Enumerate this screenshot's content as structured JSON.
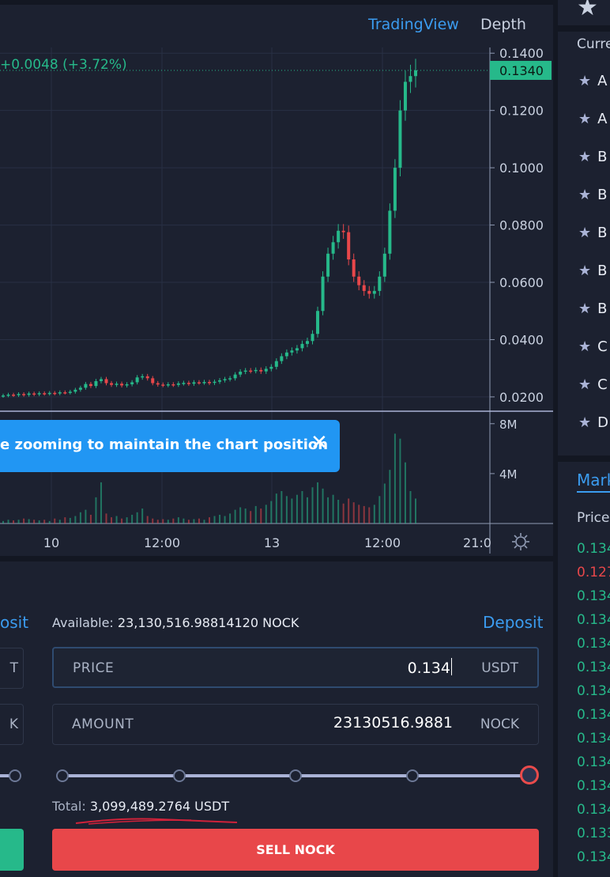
{
  "chart": {
    "tabs": {
      "tradingview": "TradingView",
      "depth": "Depth"
    },
    "change_text": "+0.0048 (+3.72%)",
    "current_price": "0.1340",
    "price_axis": [
      "0.1400",
      "0.1200",
      "0.1000",
      "0.0800",
      "0.0600",
      "0.0400",
      "0.0200"
    ],
    "volume_axis": [
      "8M",
      "4M"
    ],
    "time_axis": [
      "10",
      "12:00",
      "13",
      "12:00",
      "21:0"
    ],
    "notice_text": "e zooming to maintain the chart position",
    "colors": {
      "up": "#26b98a",
      "down": "#e8474a",
      "accent": "#3b9cf0"
    }
  },
  "order": {
    "left_deposit": "osit",
    "left_price_unit": "T",
    "left_amount_unit": "K",
    "available_label": "Available:",
    "available_value": "23,130,516.98814120 NOCK",
    "deposit_label": "Deposit",
    "price_label": "PRICE",
    "price_value": "0.134",
    "price_unit": "USDT",
    "amount_label": "AMOUNT",
    "amount_value": "23130516.9881",
    "amount_unit": "NOCK",
    "slider_percent": 100,
    "total_label": "Total:",
    "total_value": "3,099,489.2764 USDT",
    "sell_label": "SELL NOCK"
  },
  "sidebar": {
    "currency_header": "Curre",
    "pairs": [
      "A",
      "A",
      "B",
      "B",
      "B",
      "B",
      "B",
      "C",
      "C",
      "D"
    ],
    "market_tab": "Mark",
    "price_header": "Price",
    "trades": [
      {
        "price": "0.134",
        "side": "buy"
      },
      {
        "price": "0.127",
        "side": "sell"
      },
      {
        "price": "0.134",
        "side": "buy"
      },
      {
        "price": "0.134",
        "side": "buy"
      },
      {
        "price": "0.134",
        "side": "buy"
      },
      {
        "price": "0.134",
        "side": "buy"
      },
      {
        "price": "0.134",
        "side": "buy"
      },
      {
        "price": "0.134",
        "side": "buy"
      },
      {
        "price": "0.134",
        "side": "buy"
      },
      {
        "price": "0.134",
        "side": "buy"
      },
      {
        "price": "0.134",
        "side": "buy"
      },
      {
        "price": "0.134",
        "side": "buy"
      },
      {
        "price": "0.133",
        "side": "buy"
      },
      {
        "price": "0.134",
        "side": "buy"
      }
    ]
  },
  "chart_data": {
    "type": "candlestick",
    "series": [
      {
        "name": "price",
        "values": [
          0.0205,
          0.0208,
          0.0206,
          0.021,
          0.0207,
          0.0212,
          0.0209,
          0.0213,
          0.0211,
          0.0214,
          0.0212,
          0.0216,
          0.0215,
          0.0218,
          0.0225,
          0.0232,
          0.0245,
          0.0238,
          0.0255,
          0.0262,
          0.0248,
          0.0242,
          0.0246,
          0.024,
          0.0244,
          0.0251,
          0.0268,
          0.0272,
          0.0265,
          0.0248,
          0.0243,
          0.0241,
          0.0244,
          0.0242,
          0.0247,
          0.0249,
          0.0246,
          0.0251,
          0.025,
          0.0252,
          0.0249,
          0.0253,
          0.0258,
          0.0262,
          0.0265,
          0.0278,
          0.0288,
          0.0292,
          0.0291,
          0.0294,
          0.0289,
          0.0298,
          0.0305,
          0.0325,
          0.0342,
          0.0355,
          0.0362,
          0.037,
          0.0385,
          0.0395,
          0.042,
          0.05,
          0.062,
          0.07,
          0.074,
          0.078,
          0.0775,
          0.068,
          0.062,
          0.059,
          0.057,
          0.056,
          0.057,
          0.062,
          0.07,
          0.085,
          0.1,
          0.12,
          0.13,
          0.132,
          0.134
        ]
      },
      {
        "name": "volume",
        "values": [
          0.2,
          0.3,
          0.25,
          0.3,
          0.4,
          0.35,
          0.3,
          0.25,
          0.3,
          0.2,
          0.4,
          0.3,
          0.5,
          0.45,
          0.6,
          0.9,
          1.1,
          0.7,
          2.1,
          3.3,
          0.8,
          0.5,
          0.6,
          0.4,
          0.5,
          0.7,
          0.9,
          1.2,
          0.6,
          0.4,
          0.3,
          0.35,
          0.3,
          0.4,
          0.5,
          0.4,
          0.3,
          0.35,
          0.4,
          0.3,
          0.5,
          0.6,
          0.7,
          0.6,
          0.8,
          1.1,
          1.3,
          1.2,
          1.0,
          1.4,
          1.2,
          1.5,
          1.8,
          2.4,
          2.6,
          2.2,
          2.0,
          2.3,
          2.6,
          2.1,
          2.9,
          3.3,
          2.8,
          2.1,
          2.3,
          1.9,
          1.6,
          2.0,
          1.7,
          1.5,
          1.4,
          1.3,
          1.5,
          2.2,
          3.2,
          4.3,
          7.2,
          6.8,
          4.9,
          2.6,
          2.0
        ]
      }
    ],
    "ylim": [
      0.015,
      0.142
    ],
    "volume_ylim": [
      0,
      9
    ]
  }
}
